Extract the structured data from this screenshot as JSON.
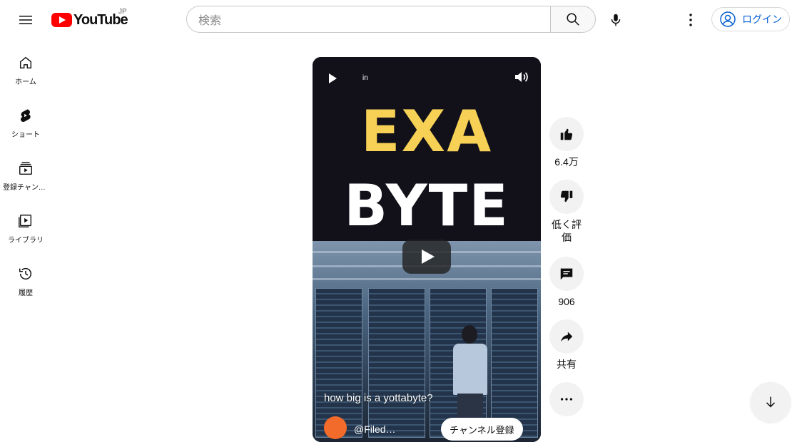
{
  "header": {
    "logo_text": "YouTube",
    "region": "JP",
    "search_placeholder": "検索",
    "login_label": "ログイン"
  },
  "sidebar": {
    "items": [
      {
        "label": "ホーム",
        "icon": "home-icon"
      },
      {
        "label": "ショート",
        "icon": "shorts-icon"
      },
      {
        "label": "登録チャンネル",
        "icon": "subscriptions-icon"
      },
      {
        "label": "ライブラリ",
        "icon": "library-icon"
      },
      {
        "label": "履歴",
        "icon": "history-icon"
      }
    ]
  },
  "player": {
    "overlay_tag": "in",
    "title_line1": "EXA",
    "title_line2": "BYTE",
    "caption": "how big is a yottabyte?",
    "channel_name": "@Filed…",
    "subscribe_label": "チャンネル登録",
    "colors": {
      "accent_yellow": "#f7d155",
      "bg": "#12111a"
    }
  },
  "actions": {
    "like_count": "6.4万",
    "dislike_label": "低く評価",
    "comment_count": "906",
    "share_label": "共有"
  }
}
